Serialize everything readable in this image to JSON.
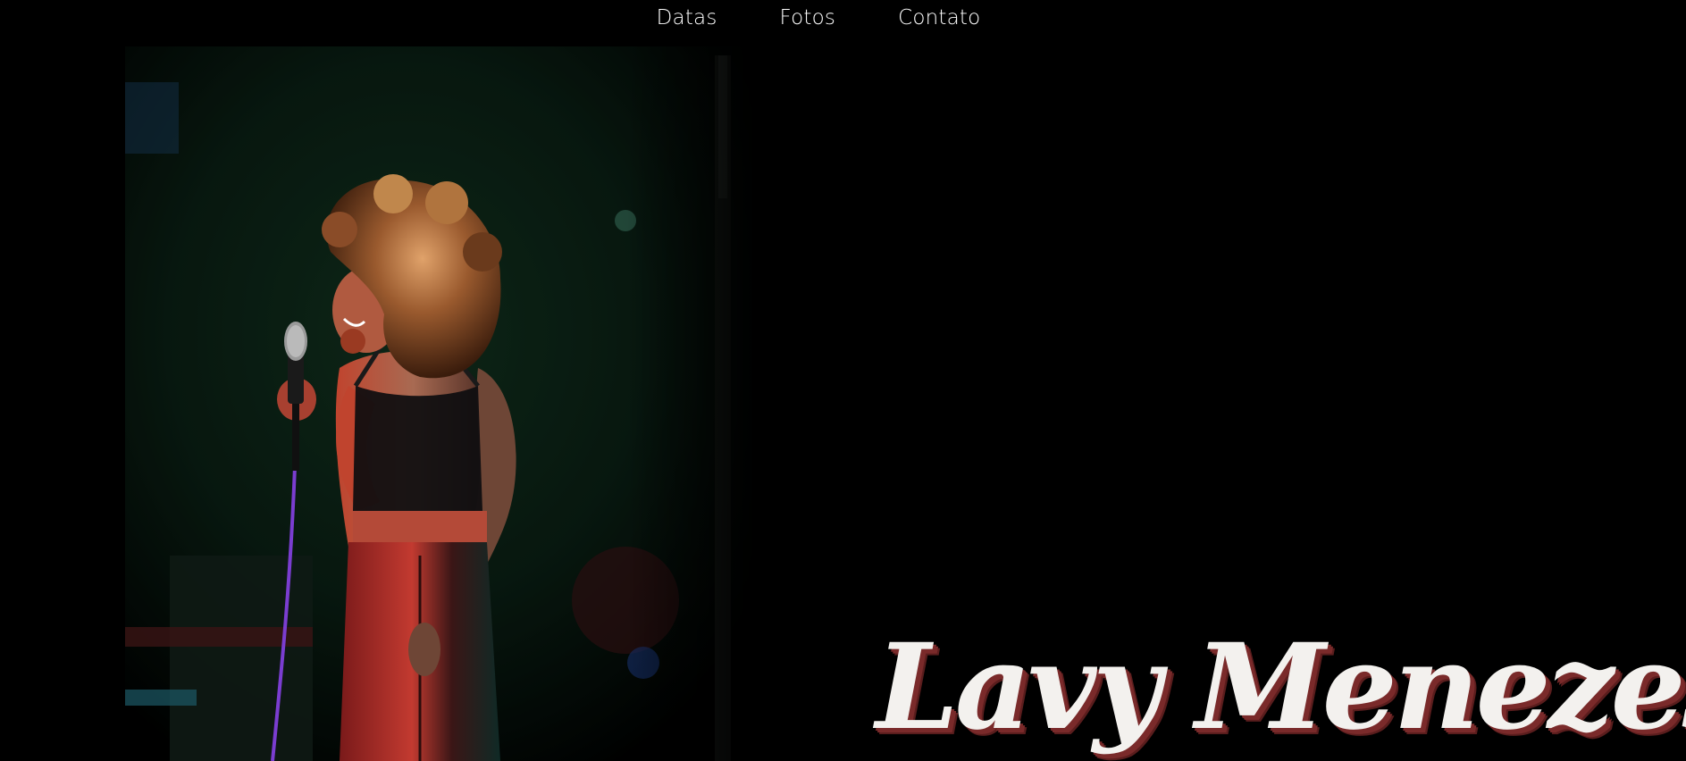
{
  "nav": {
    "items": [
      {
        "label": "Datas"
      },
      {
        "label": "Fotos"
      },
      {
        "label": "Contato"
      }
    ]
  },
  "hero": {
    "artist_name": "Lavy Menezes"
  },
  "colors": {
    "background": "#000000",
    "nav_text": "#ffffff",
    "name_fill": "#f3f1ee",
    "name_shadow": "#7a2a2a",
    "stage_green": "#0c2a1c",
    "stage_red": "#c2372f"
  },
  "icons": [
    "microphone-icon"
  ]
}
